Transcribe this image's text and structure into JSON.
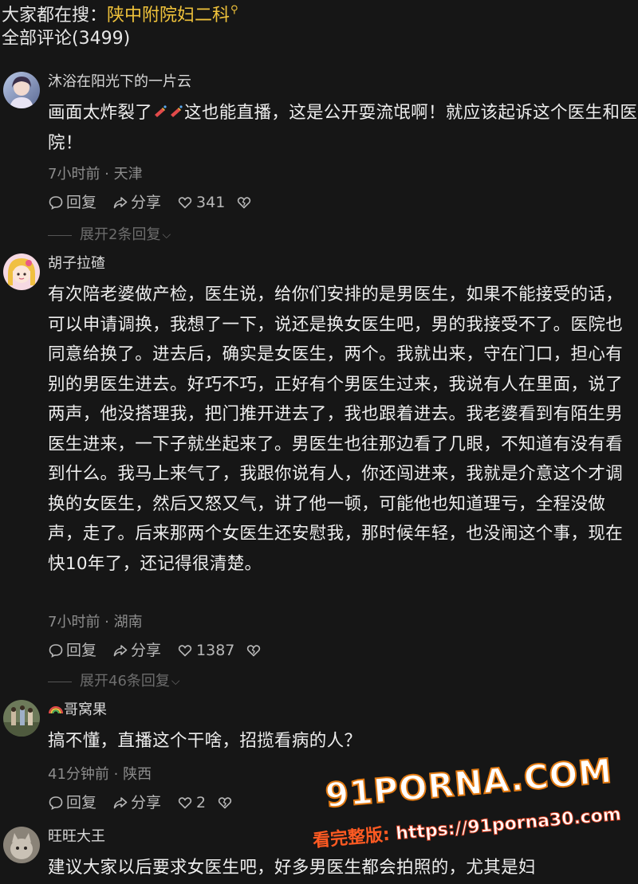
{
  "header": {
    "search_prefix": "大家都在搜：",
    "search_term": "陕中附院妇二科",
    "comment_count_label": "全部评论(3499)"
  },
  "comments": [
    {
      "username": "沐浴在阳光下的一片云",
      "content_before_emoji": "画面太炸裂了",
      "content_after_emoji": "这也能直播，这是公开耍流氓啊！就应该起诉这个医生和医院！",
      "meta": "7小时前 · 天津",
      "reply_label": "回复",
      "share_label": "分享",
      "likes": "341",
      "expand_label": "展开2条回复"
    },
    {
      "username": "胡子拉碴",
      "content": "有次陪老婆做产检，医生说，给你们安排的是男医生，如果不能接受的话，可以申请调换，我想了一下，说还是换女医生吧，男的我接受不了。医院也同意给换了。进去后，确实是女医生，两个。我就出来，守在门口，担心有别的男医生进去。好巧不巧，正好有个男医生过来，我说有人在里面，说了两声，他没搭理我，把门推开进去了，我也跟着进去。我老婆看到有陌生男医生进来，一下子就坐起来了。男医生也往那边看了几眼，不知道有没有看到什么。我马上来气了，我跟你说有人，你还闯进来，我就是介意这个才调换的女医生，然后又怒又气，讲了他一顿，可能他也知道理亏，全程没做声，走了。后来那两个女医生还安慰我，那时候年轻，也没闹这个事，现在快10年了，还记得很清楚。",
      "meta": "7小时前 · 湖南",
      "reply_label": "回复",
      "share_label": "分享",
      "likes": "1387",
      "expand_label": "展开46条回复"
    },
    {
      "username": "哥窝果",
      "content": "搞不懂，直播这个干啥，招揽看病的人？",
      "meta": "41分钟前 · 陕西",
      "reply_label": "回复",
      "share_label": "分享",
      "likes": "2"
    },
    {
      "username": "旺旺大王",
      "content": "建议大家以后要求女医生吧，好多男医生都会拍照的，尤其是妇"
    }
  ],
  "watermark": {
    "logo": "91PORNA.COM",
    "url_prefix": "看完整版:",
    "url": "https://91porna30.com"
  },
  "icons": {
    "search": "search-icon",
    "reply": "comment-bubble-icon",
    "share": "share-arrow-icon",
    "like": "heart-icon",
    "dislike": "broken-heart-icon",
    "expand": "chevron-down-icon"
  }
}
